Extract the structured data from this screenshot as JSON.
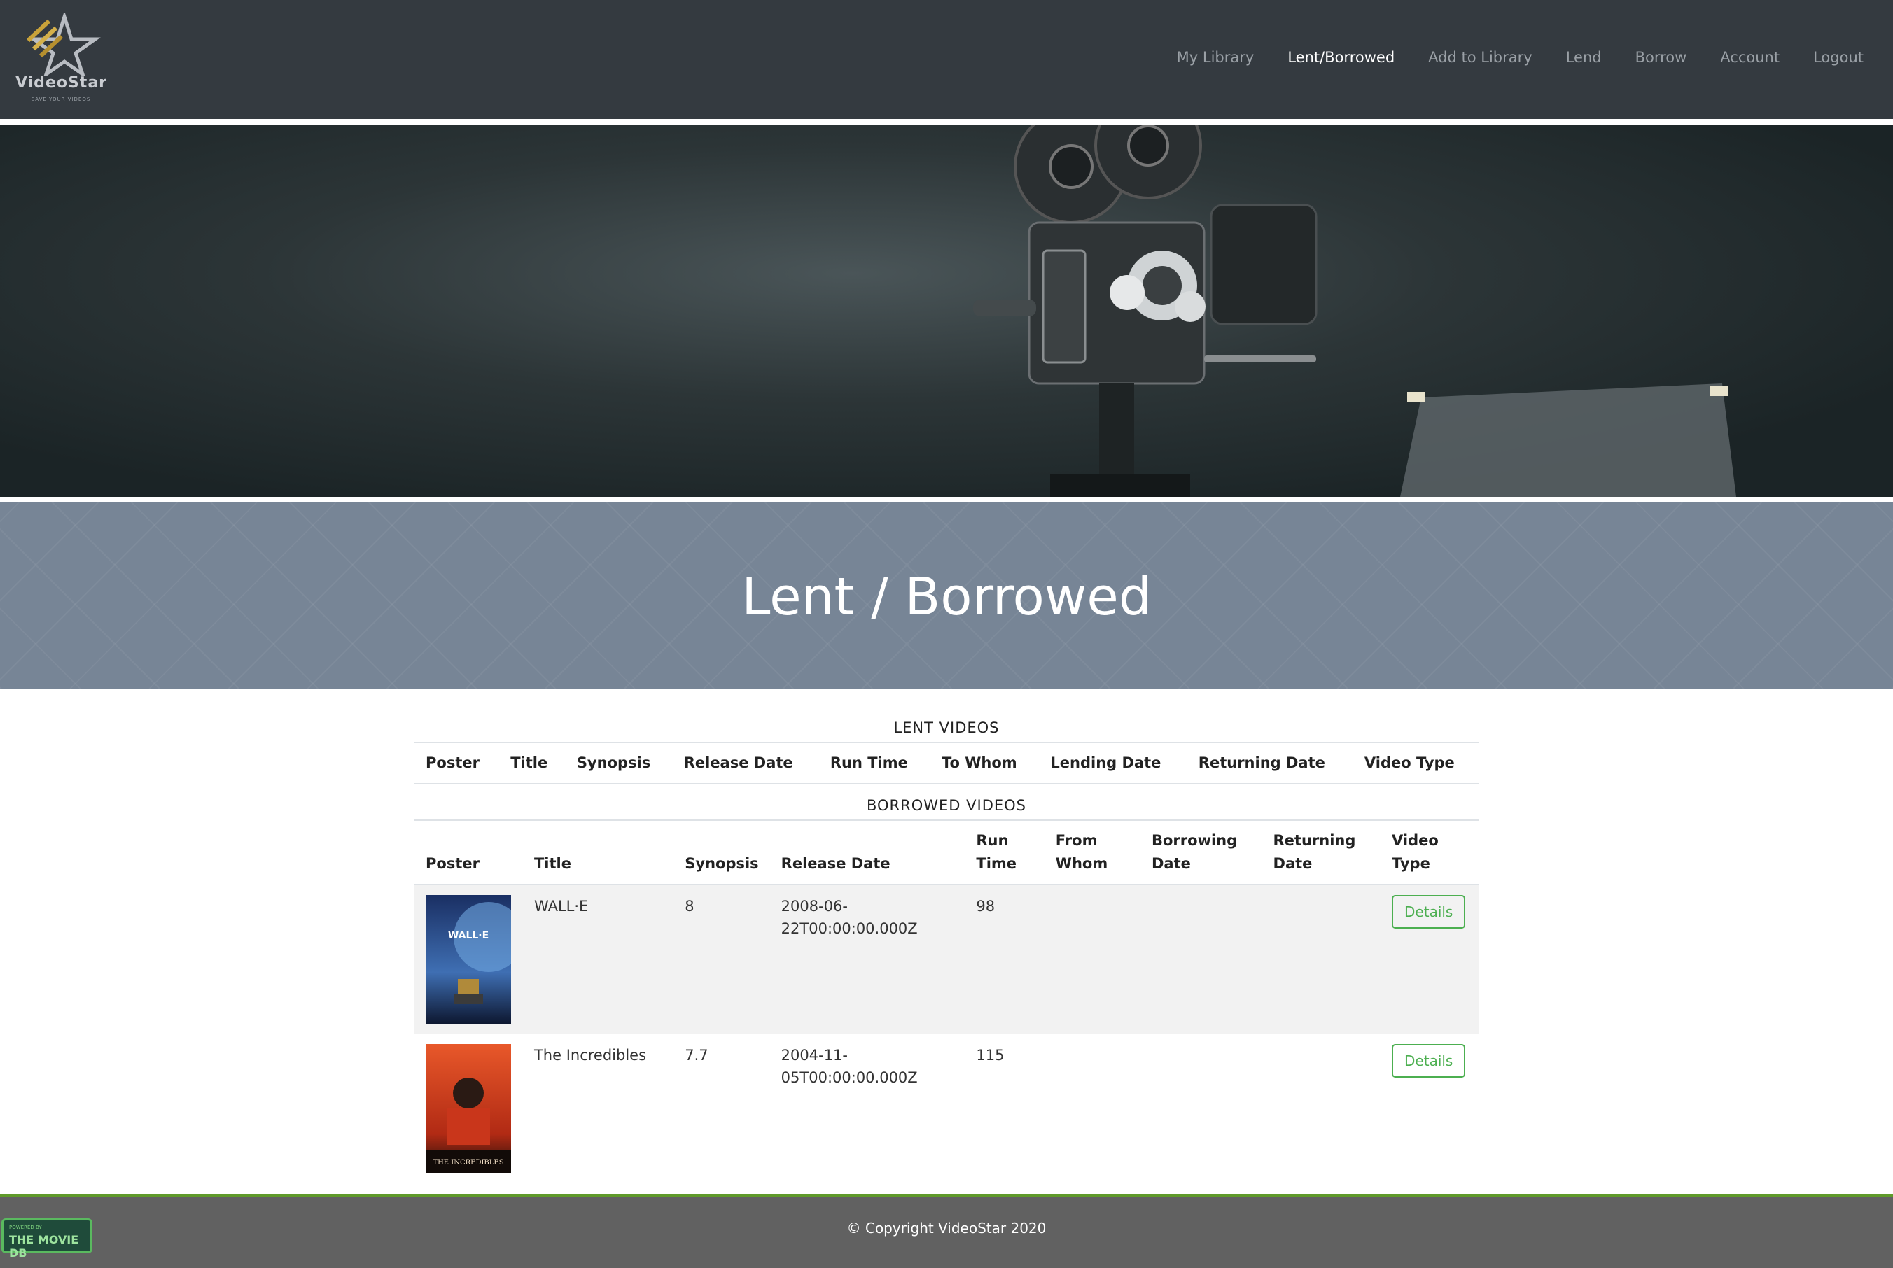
{
  "brand": {
    "name": "VideoStar",
    "tagline": "SAVE YOUR VIDEOS"
  },
  "nav": {
    "items": [
      {
        "label": "My Library",
        "active": false
      },
      {
        "label": "Lent/Borrowed",
        "active": true
      },
      {
        "label": "Add to Library",
        "active": false
      },
      {
        "label": "Lend",
        "active": false
      },
      {
        "label": "Borrow",
        "active": false
      },
      {
        "label": "Account",
        "active": false
      },
      {
        "label": "Logout",
        "active": false
      }
    ]
  },
  "page_title": "Lent / Borrowed",
  "lent": {
    "caption": "LENT VIDEOS",
    "columns": [
      "Poster",
      "Title",
      "Synopsis",
      "Release Date",
      "Run Time",
      "To Whom",
      "Lending Date",
      "Returning Date",
      "Video Type"
    ]
  },
  "borrowed": {
    "caption": "BORROWED VIDEOS",
    "columns": [
      "Poster",
      "Title",
      "Synopsis",
      "Release Date",
      "Run Time",
      "From Whom",
      "Borrowing Date",
      "Returning Date",
      "Video Type"
    ],
    "rows": [
      {
        "title": "WALL·E",
        "synopsis": "8",
        "release_date": "2008-06-22T00:00:00.000Z",
        "run_time": "98",
        "from_whom": "",
        "borrowing_date": "",
        "returning_date": "",
        "action": "Details",
        "poster_text": "WALL·E"
      },
      {
        "title": "The Incredibles",
        "synopsis": "7.7",
        "release_date": "2004-11-05T00:00:00.000Z",
        "run_time": "115",
        "from_whom": "",
        "borrowing_date": "",
        "returning_date": "",
        "action": "Details",
        "poster_text": "THE INCREDIBLES"
      }
    ]
  },
  "footer": {
    "copyright": "© Copyright VideoStar 2020",
    "tmdb_small": "POWERED BY",
    "tmdb_big": "THE MOVIE DB"
  },
  "colors": {
    "navbar": "#343a40",
    "band": "#778596",
    "footer": "#616161",
    "accent": "#4caf50"
  }
}
